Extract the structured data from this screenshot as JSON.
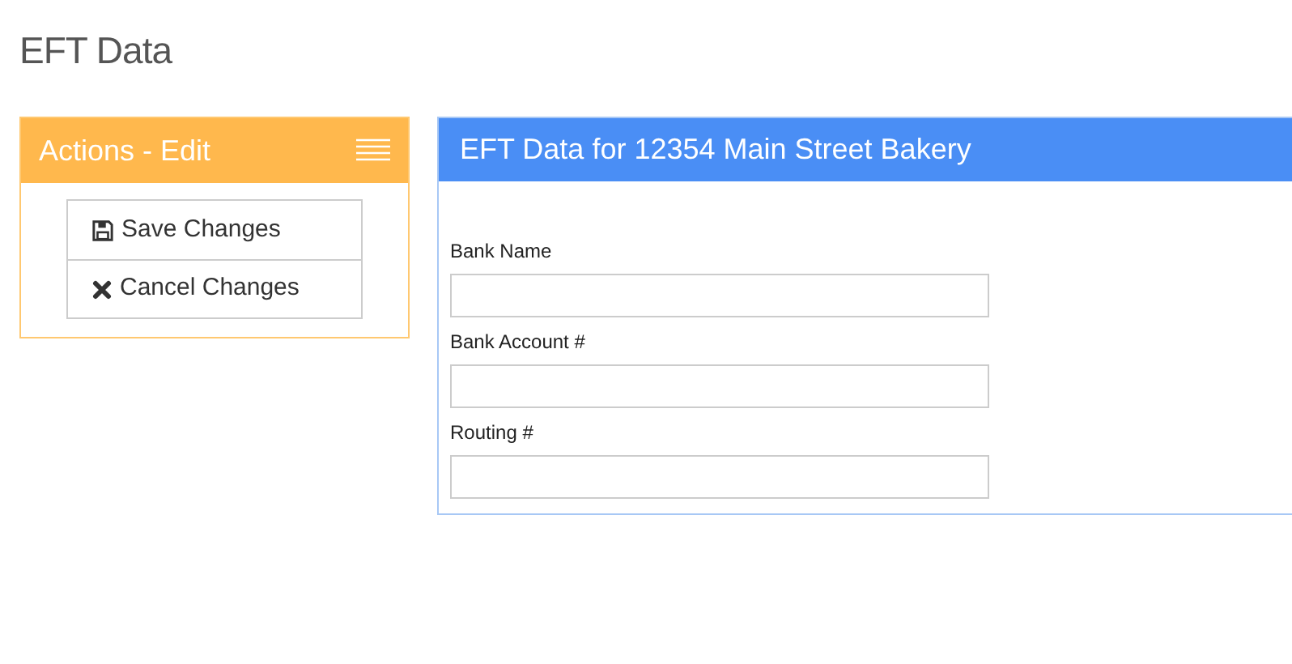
{
  "page_title": "EFT Data",
  "actions_panel": {
    "title": "Actions - Edit",
    "actions": [
      {
        "kind": "save",
        "label": "Save Changes"
      },
      {
        "kind": "cancel",
        "label": "Cancel Changes"
      }
    ]
  },
  "form_panel": {
    "title": "EFT Data for 12354 Main Street Bakery",
    "fields": [
      {
        "label": "Bank Name"
      },
      {
        "label": "Bank Account #"
      },
      {
        "label": "Routing #"
      }
    ]
  }
}
